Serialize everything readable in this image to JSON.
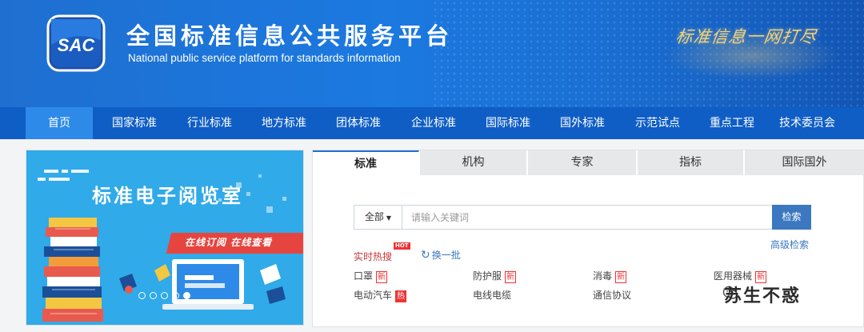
{
  "header": {
    "title": "全国标准信息公共服务平台",
    "subtitle": "National public service platform  for standards information",
    "slogan": "标准信息一网打尽",
    "logo_text": "SAC"
  },
  "nav": [
    {
      "label": "首页",
      "active": true
    },
    {
      "label": "国家标准"
    },
    {
      "label": "行业标准"
    },
    {
      "label": "地方标准"
    },
    {
      "label": "团体标准"
    },
    {
      "label": "企业标准"
    },
    {
      "label": "国际标准"
    },
    {
      "label": "国外标准"
    },
    {
      "label": "示范试点"
    },
    {
      "label": "重点工程"
    },
    {
      "label": "技术委员会"
    }
  ],
  "banner": {
    "title": "标准电子阅览室",
    "ribbon": "在线订阅   在线查看",
    "slides": 5,
    "current_slide": 5
  },
  "tabs": [
    {
      "label": "标准",
      "active": true
    },
    {
      "label": "机构"
    },
    {
      "label": "专家"
    },
    {
      "label": "指标"
    },
    {
      "label": "国际国外"
    }
  ],
  "search": {
    "scope": "全部",
    "placeholder": "请输入关键词",
    "button": "检索",
    "advanced": "高级检索"
  },
  "hot": {
    "label": "实时热搜",
    "badge": "HOT",
    "refresh": "换一批",
    "keywords": [
      {
        "text": "口罩",
        "tag": "新"
      },
      {
        "text": "防护服",
        "tag": "新"
      },
      {
        "text": "消毒",
        "tag": "新"
      },
      {
        "text": "医用器械",
        "tag": "新"
      },
      {
        "text": "电动汽车",
        "tag": "热"
      },
      {
        "text": "电线电缆",
        "tag": ""
      },
      {
        "text": "通信协议",
        "tag": ""
      }
    ]
  },
  "watermark": "苏生不惑",
  "colors": {
    "brand": "#1b79e0",
    "nav": "#0f5ec5",
    "nav_active": "#2d8ae8",
    "button": "#3b78c0",
    "hot": "#e33333"
  }
}
